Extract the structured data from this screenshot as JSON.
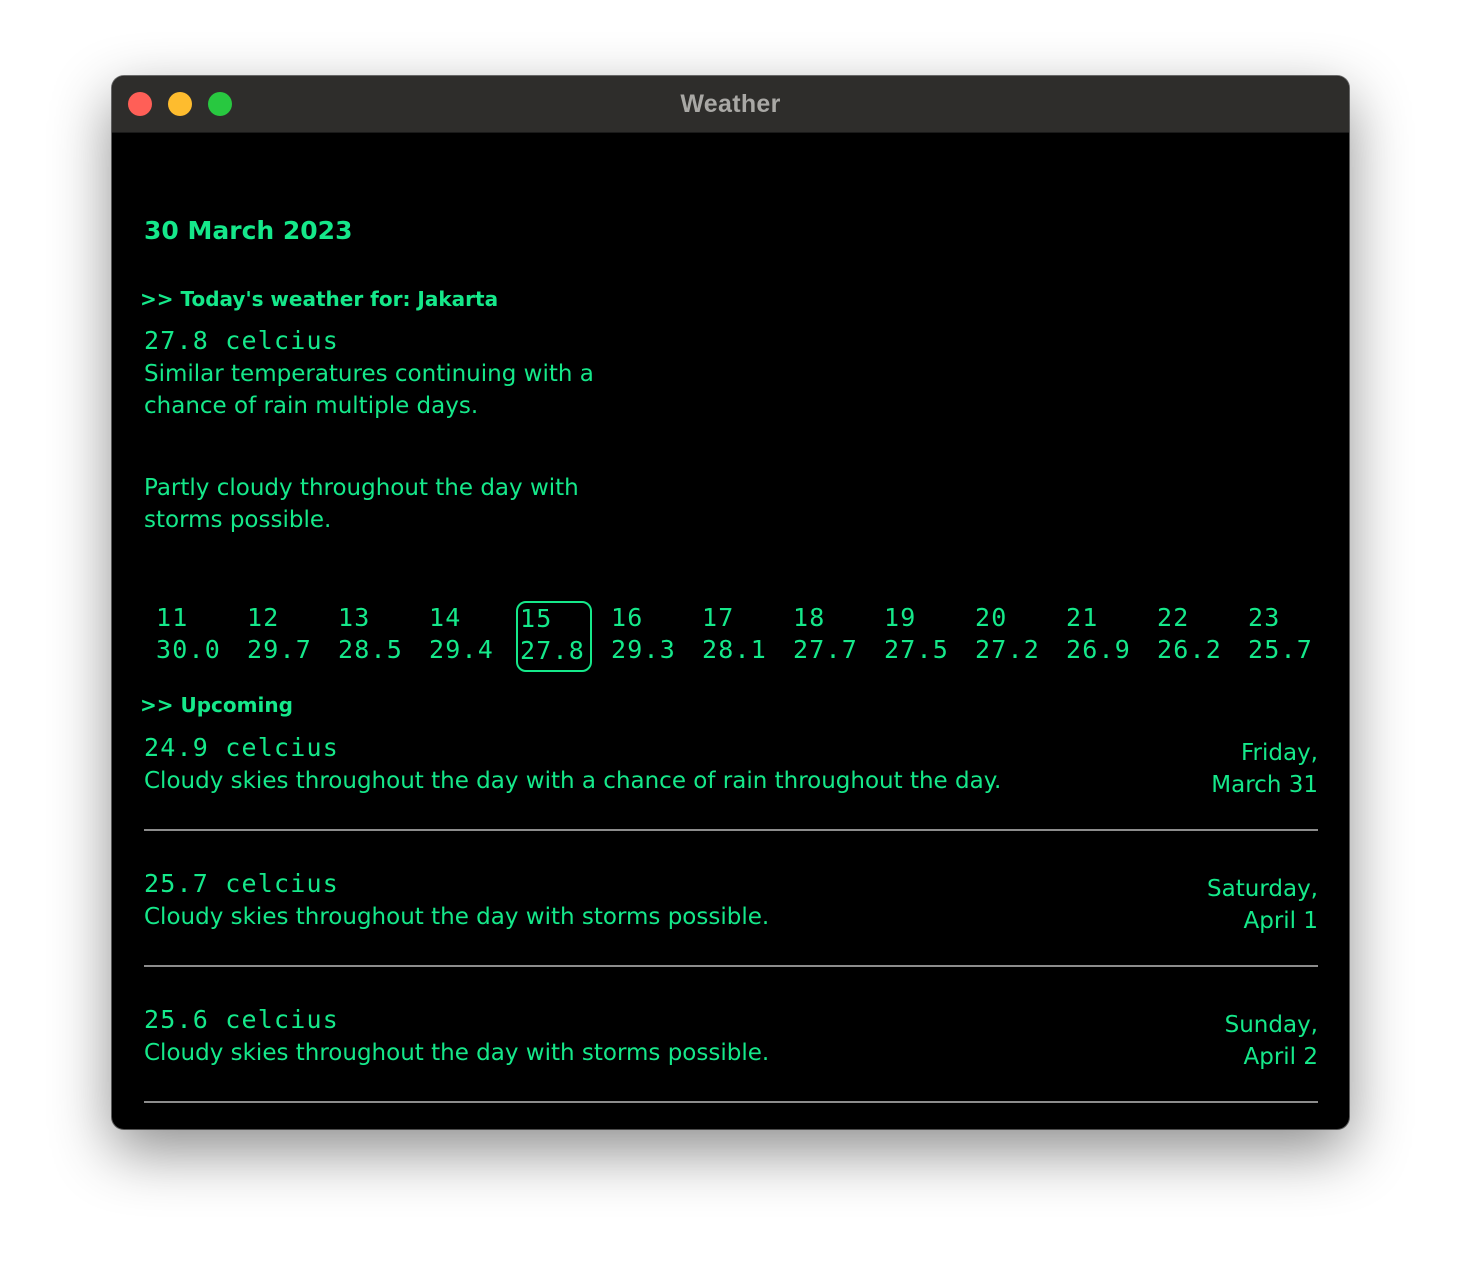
{
  "window": {
    "title": "Weather"
  },
  "today": {
    "date": "30 March 2023",
    "heading": ">> Today's weather for: Jakarta",
    "temperature": "27.8 celcius",
    "summary": "Similar temperatures continuing with a chance of rain multiple days.",
    "condition": "Partly cloudy throughout the day with storms possible."
  },
  "hourly": [
    {
      "hour": "11",
      "temp": "30.0"
    },
    {
      "hour": "12",
      "temp": "29.7"
    },
    {
      "hour": "13",
      "temp": "28.5"
    },
    {
      "hour": "14",
      "temp": "29.4"
    },
    {
      "hour": "15",
      "temp": "27.8",
      "current": true
    },
    {
      "hour": "16",
      "temp": "29.3"
    },
    {
      "hour": "17",
      "temp": "28.1"
    },
    {
      "hour": "18",
      "temp": "27.7"
    },
    {
      "hour": "19",
      "temp": "27.5"
    },
    {
      "hour": "20",
      "temp": "27.2"
    },
    {
      "hour": "21",
      "temp": "26.9"
    },
    {
      "hour": "22",
      "temp": "26.2"
    },
    {
      "hour": "23",
      "temp": "25.7"
    }
  ],
  "upcoming": {
    "heading": ">> Upcoming",
    "days": [
      {
        "temperature": "24.9 celcius",
        "description": "Cloudy skies throughout the day with a chance of rain throughout the day.",
        "weekday": "Friday,",
        "date": "March 31"
      },
      {
        "temperature": "25.7 celcius",
        "description": "Cloudy skies throughout the day with storms possible.",
        "weekday": "Saturday,",
        "date": "April 1"
      },
      {
        "temperature": "25.6 celcius",
        "description": "Cloudy skies throughout the day with storms possible.",
        "weekday": "Sunday,",
        "date": "April 2"
      }
    ]
  },
  "colors": {
    "accent": "#15e88a",
    "background": "#000000",
    "titlebar": "#2e2d2b",
    "divider": "#8c8c8c"
  }
}
